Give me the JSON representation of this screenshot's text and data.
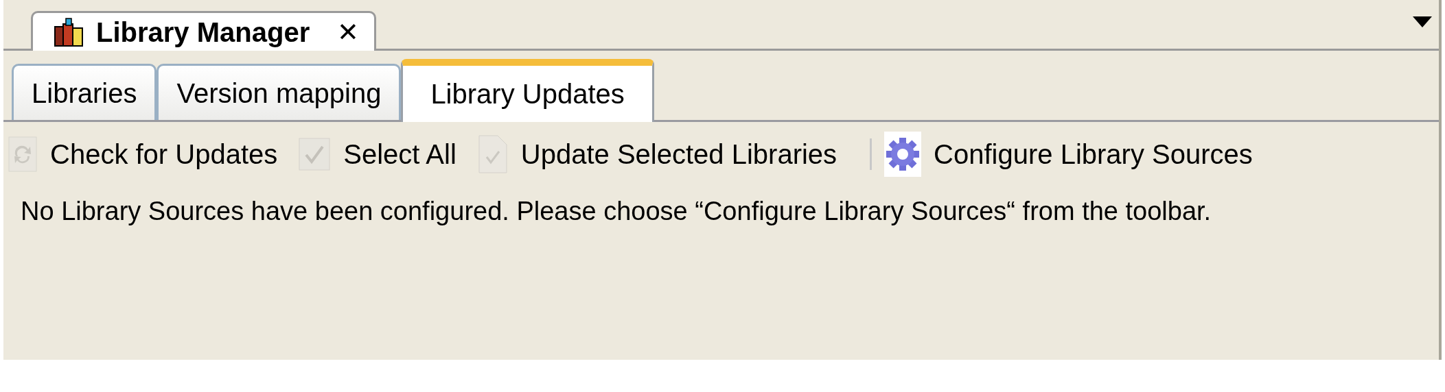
{
  "document_tab": {
    "title": "Library Manager",
    "close": "✕"
  },
  "tabs": [
    {
      "label": "Libraries",
      "selected": false
    },
    {
      "label": "Version mapping",
      "selected": false
    },
    {
      "label": "Library Updates",
      "selected": true
    }
  ],
  "toolbar": [
    {
      "kind": "refresh",
      "label": "Check for Updates",
      "disabled": true
    },
    {
      "kind": "check",
      "label": "Select All",
      "disabled": true
    },
    {
      "kind": "document",
      "label": "Update Selected Libraries",
      "disabled": true
    },
    {
      "kind": "separator"
    },
    {
      "kind": "gear",
      "label": "Configure Library Sources",
      "disabled": false
    }
  ],
  "message": "No Library Sources have been configured. Please choose “Configure Library Sources“ from the toolbar."
}
